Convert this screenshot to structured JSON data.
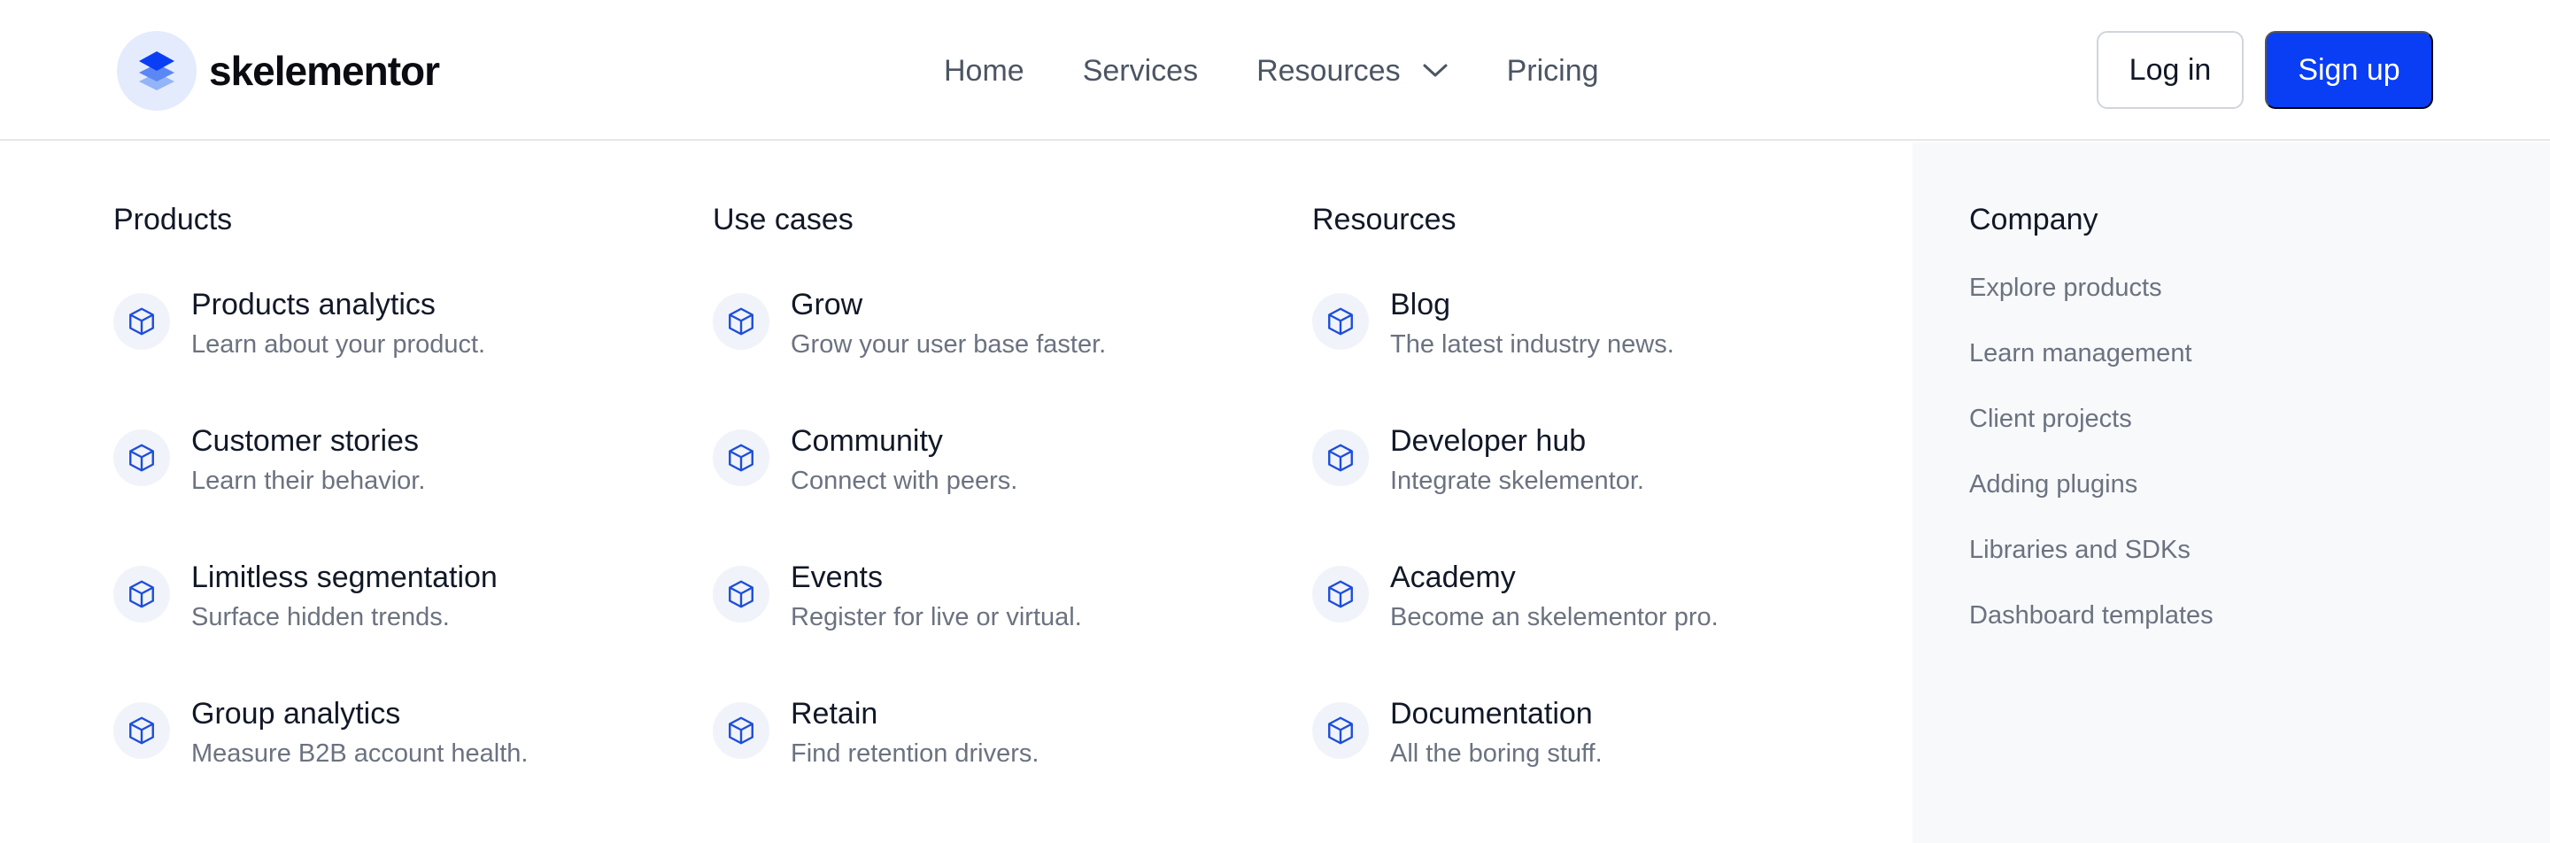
{
  "brand": {
    "name": "skelementor",
    "logo_icon": "stacked-layers-icon"
  },
  "nav": {
    "items": [
      {
        "label": "Home"
      },
      {
        "label": "Services"
      },
      {
        "label": "Resources",
        "icon": "chevron-down-icon"
      },
      {
        "label": "Pricing"
      }
    ]
  },
  "auth": {
    "login_label": "Log in",
    "signup_label": "Sign up"
  },
  "colors": {
    "accent": "#0a3ef5",
    "icon_blue": "#1d4ed8",
    "panel_bg": "#f8f9fb"
  },
  "mega_menu": {
    "columns": [
      {
        "title": "Products",
        "items": [
          {
            "title": "Products analytics",
            "desc": "Learn about your product.",
            "icon": "cube-icon"
          },
          {
            "title": "Customer stories",
            "desc": "Learn their behavior.",
            "icon": "cube-icon"
          },
          {
            "title": "Limitless segmentation",
            "desc": "Surface hidden trends.",
            "icon": "cube-icon"
          },
          {
            "title": "Group analytics",
            "desc": "Measure B2B account health.",
            "icon": "cube-icon"
          }
        ]
      },
      {
        "title": "Use cases",
        "items": [
          {
            "title": "Grow",
            "desc": "Grow your user base faster.",
            "icon": "cube-icon"
          },
          {
            "title": "Community",
            "desc": "Connect with peers.",
            "icon": "cube-icon"
          },
          {
            "title": "Events",
            "desc": "Register for live or virtual.",
            "icon": "cube-icon"
          },
          {
            "title": "Retain",
            "desc": "Find retention drivers.",
            "icon": "cube-icon"
          }
        ]
      },
      {
        "title": "Resources",
        "items": [
          {
            "title": "Blog",
            "desc": "The latest industry news.",
            "icon": "cube-icon"
          },
          {
            "title": "Developer hub",
            "desc": "Integrate skelementor.",
            "icon": "cube-icon"
          },
          {
            "title": "Academy",
            "desc": "Become an skelementor pro.",
            "icon": "cube-icon"
          },
          {
            "title": "Documentation",
            "desc": "All the boring stuff.",
            "icon": "cube-icon"
          }
        ]
      }
    ],
    "company": {
      "title": "Company",
      "links": [
        "Explore products",
        "Learn management",
        "Client projects",
        "Adding plugins",
        "Libraries and SDKs",
        "Dashboard templates"
      ]
    }
  }
}
